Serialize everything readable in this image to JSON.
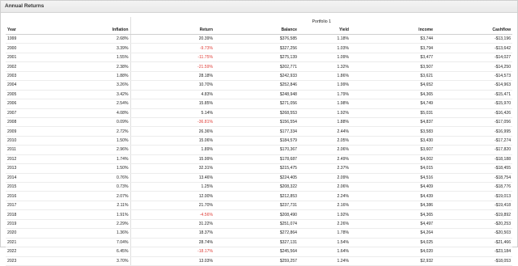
{
  "panel": {
    "title": "Annual Returns"
  },
  "table": {
    "group_label": "Portfolio 1",
    "headers": {
      "year": "Year",
      "inflation": "Inflation",
      "return": "Return",
      "balance": "Balance",
      "yield": "Yield",
      "income": "Income",
      "cashflow": "Cashflow"
    },
    "colors": {
      "negative": "#e0403a"
    },
    "rows": [
      {
        "year": "1999",
        "inflation": "2.68%",
        "return": "20.39%",
        "balance": "$376,585",
        "yield": "1.18%",
        "income": "$3,744",
        "cashflow": "-$13,196"
      },
      {
        "year": "2000",
        "inflation": "3.39%",
        "return": "-9.73%",
        "balance": "$327,256",
        "yield": "1.03%",
        "income": "$3,794",
        "cashflow": "-$13,642"
      },
      {
        "year": "2001",
        "inflation": "1.55%",
        "return": "-11.75%",
        "balance": "$275,139",
        "yield": "1.09%",
        "income": "$3,477",
        "cashflow": "-$14,027"
      },
      {
        "year": "2002",
        "inflation": "2.38%",
        "return": "-21.59%",
        "balance": "$202,771",
        "yield": "1.32%",
        "income": "$3,507",
        "cashflow": "-$14,250"
      },
      {
        "year": "2003",
        "inflation": "1.88%",
        "return": "28.18%",
        "balance": "$242,933",
        "yield": "1.86%",
        "income": "$3,621",
        "cashflow": "-$14,573"
      },
      {
        "year": "2004",
        "inflation": "3.26%",
        "return": "10.70%",
        "balance": "$252,846",
        "yield": "1.99%",
        "income": "$4,652",
        "cashflow": "-$14,963"
      },
      {
        "year": "2005",
        "inflation": "3.42%",
        "return": "4.83%",
        "balance": "$248,948",
        "yield": "1.79%",
        "income": "$4,365",
        "cashflow": "-$15,471"
      },
      {
        "year": "2006",
        "inflation": "2.54%",
        "return": "15.85%",
        "balance": "$271,056",
        "yield": "1.98%",
        "income": "$4,749",
        "cashflow": "-$15,970"
      },
      {
        "year": "2007",
        "inflation": "4.08%",
        "return": "5.14%",
        "balance": "$268,553",
        "yield": "1.92%",
        "income": "$5,031",
        "cashflow": "-$16,426"
      },
      {
        "year": "2008",
        "inflation": "0.09%",
        "return": "-36.81%",
        "balance": "$156,554",
        "yield": "1.88%",
        "income": "$4,837",
        "cashflow": "-$17,056"
      },
      {
        "year": "2009",
        "inflation": "2.72%",
        "return": "26.36%",
        "balance": "$177,334",
        "yield": "2.44%",
        "income": "$3,583",
        "cashflow": "-$16,995"
      },
      {
        "year": "2010",
        "inflation": "1.50%",
        "return": "15.06%",
        "balance": "$184,579",
        "yield": "2.05%",
        "income": "$3,430",
        "cashflow": "-$17,274"
      },
      {
        "year": "2011",
        "inflation": "2.96%",
        "return": "1.89%",
        "balance": "$170,367",
        "yield": "2.06%",
        "income": "$3,607",
        "cashflow": "-$17,820"
      },
      {
        "year": "2012",
        "inflation": "1.74%",
        "return": "15.99%",
        "balance": "$178,687",
        "yield": "2.49%",
        "income": "$4,002",
        "cashflow": "-$18,188"
      },
      {
        "year": "2013",
        "inflation": "1.50%",
        "return": "32.31%",
        "balance": "$215,475",
        "yield": "2.37%",
        "income": "$4,015",
        "cashflow": "-$18,455"
      },
      {
        "year": "2014",
        "inflation": "0.76%",
        "return": "13.46%",
        "balance": "$224,405",
        "yield": "2.09%",
        "income": "$4,516",
        "cashflow": "-$18,754"
      },
      {
        "year": "2015",
        "inflation": "0.73%",
        "return": "1.25%",
        "balance": "$208,322",
        "yield": "2.06%",
        "income": "$4,409",
        "cashflow": "-$18,776"
      },
      {
        "year": "2016",
        "inflation": "2.07%",
        "return": "12.00%",
        "balance": "$212,853",
        "yield": "2.24%",
        "income": "$4,439",
        "cashflow": "-$19,013"
      },
      {
        "year": "2017",
        "inflation": "2.11%",
        "return": "21.70%",
        "balance": "$237,731",
        "yield": "2.16%",
        "income": "$4,386",
        "cashflow": "-$19,418"
      },
      {
        "year": "2018",
        "inflation": "1.91%",
        "return": "-4.56%",
        "balance": "$208,490",
        "yield": "1.92%",
        "income": "$4,365",
        "cashflow": "-$19,892"
      },
      {
        "year": "2019",
        "inflation": "2.29%",
        "return": "31.22%",
        "balance": "$251,074",
        "yield": "2.26%",
        "income": "$4,497",
        "cashflow": "-$20,253"
      },
      {
        "year": "2020",
        "inflation": "1.36%",
        "return": "18.37%",
        "balance": "$272,864",
        "yield": "1.78%",
        "income": "$4,264",
        "cashflow": "-$20,503"
      },
      {
        "year": "2021",
        "inflation": "7.04%",
        "return": "28.74%",
        "balance": "$327,131",
        "yield": "1.54%",
        "income": "$4,025",
        "cashflow": "-$21,466"
      },
      {
        "year": "2022",
        "inflation": "6.45%",
        "return": "-18.17%",
        "balance": "$245,564",
        "yield": "1.64%",
        "income": "$4,020",
        "cashflow": "-$23,184"
      },
      {
        "year": "2023",
        "inflation": "3.70%",
        "return": "13.03%",
        "balance": "$259,257",
        "yield": "1.24%",
        "income": "$2,932",
        "cashflow": "-$18,053"
      }
    ]
  }
}
